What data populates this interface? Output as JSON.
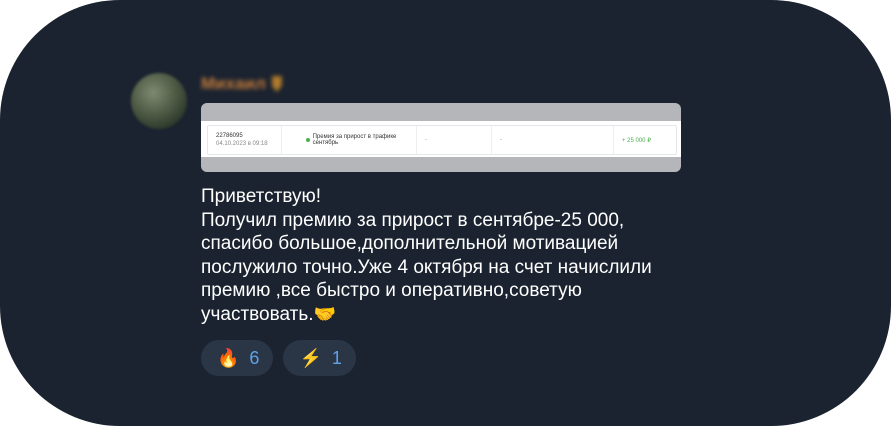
{
  "message": {
    "author": "Михаил",
    "attachment": {
      "operation_id": "22786095",
      "datetime": "04.10.2023 в 09:18",
      "description_line1": "Премия за прирост в трафике",
      "description_line2": "сентябрь",
      "col3": "-",
      "col4": "-",
      "amount": "+ 25 000 ₽"
    },
    "text": "Приветствую!\nПолучил премию за прирост в сентябре-25 000, спасибо большое,дополнительной мотивацией послужило точно.Уже 4 октября на счет начислили премию ,все быстро и оперативно,советую участвовать.",
    "trailing_emoji": "🤝"
  },
  "reactions": [
    {
      "icon": "🔥",
      "icon_name": "fire-icon",
      "count": "6"
    },
    {
      "icon": "⚡",
      "icon_name": "lightning-icon",
      "count": "1"
    }
  ],
  "colors": {
    "bubble_bg": "#1b2330",
    "author": "#c27a3a",
    "reaction_bg": "#2a3646",
    "reaction_count": "#5ea2e8",
    "amount": "#4caf50"
  }
}
